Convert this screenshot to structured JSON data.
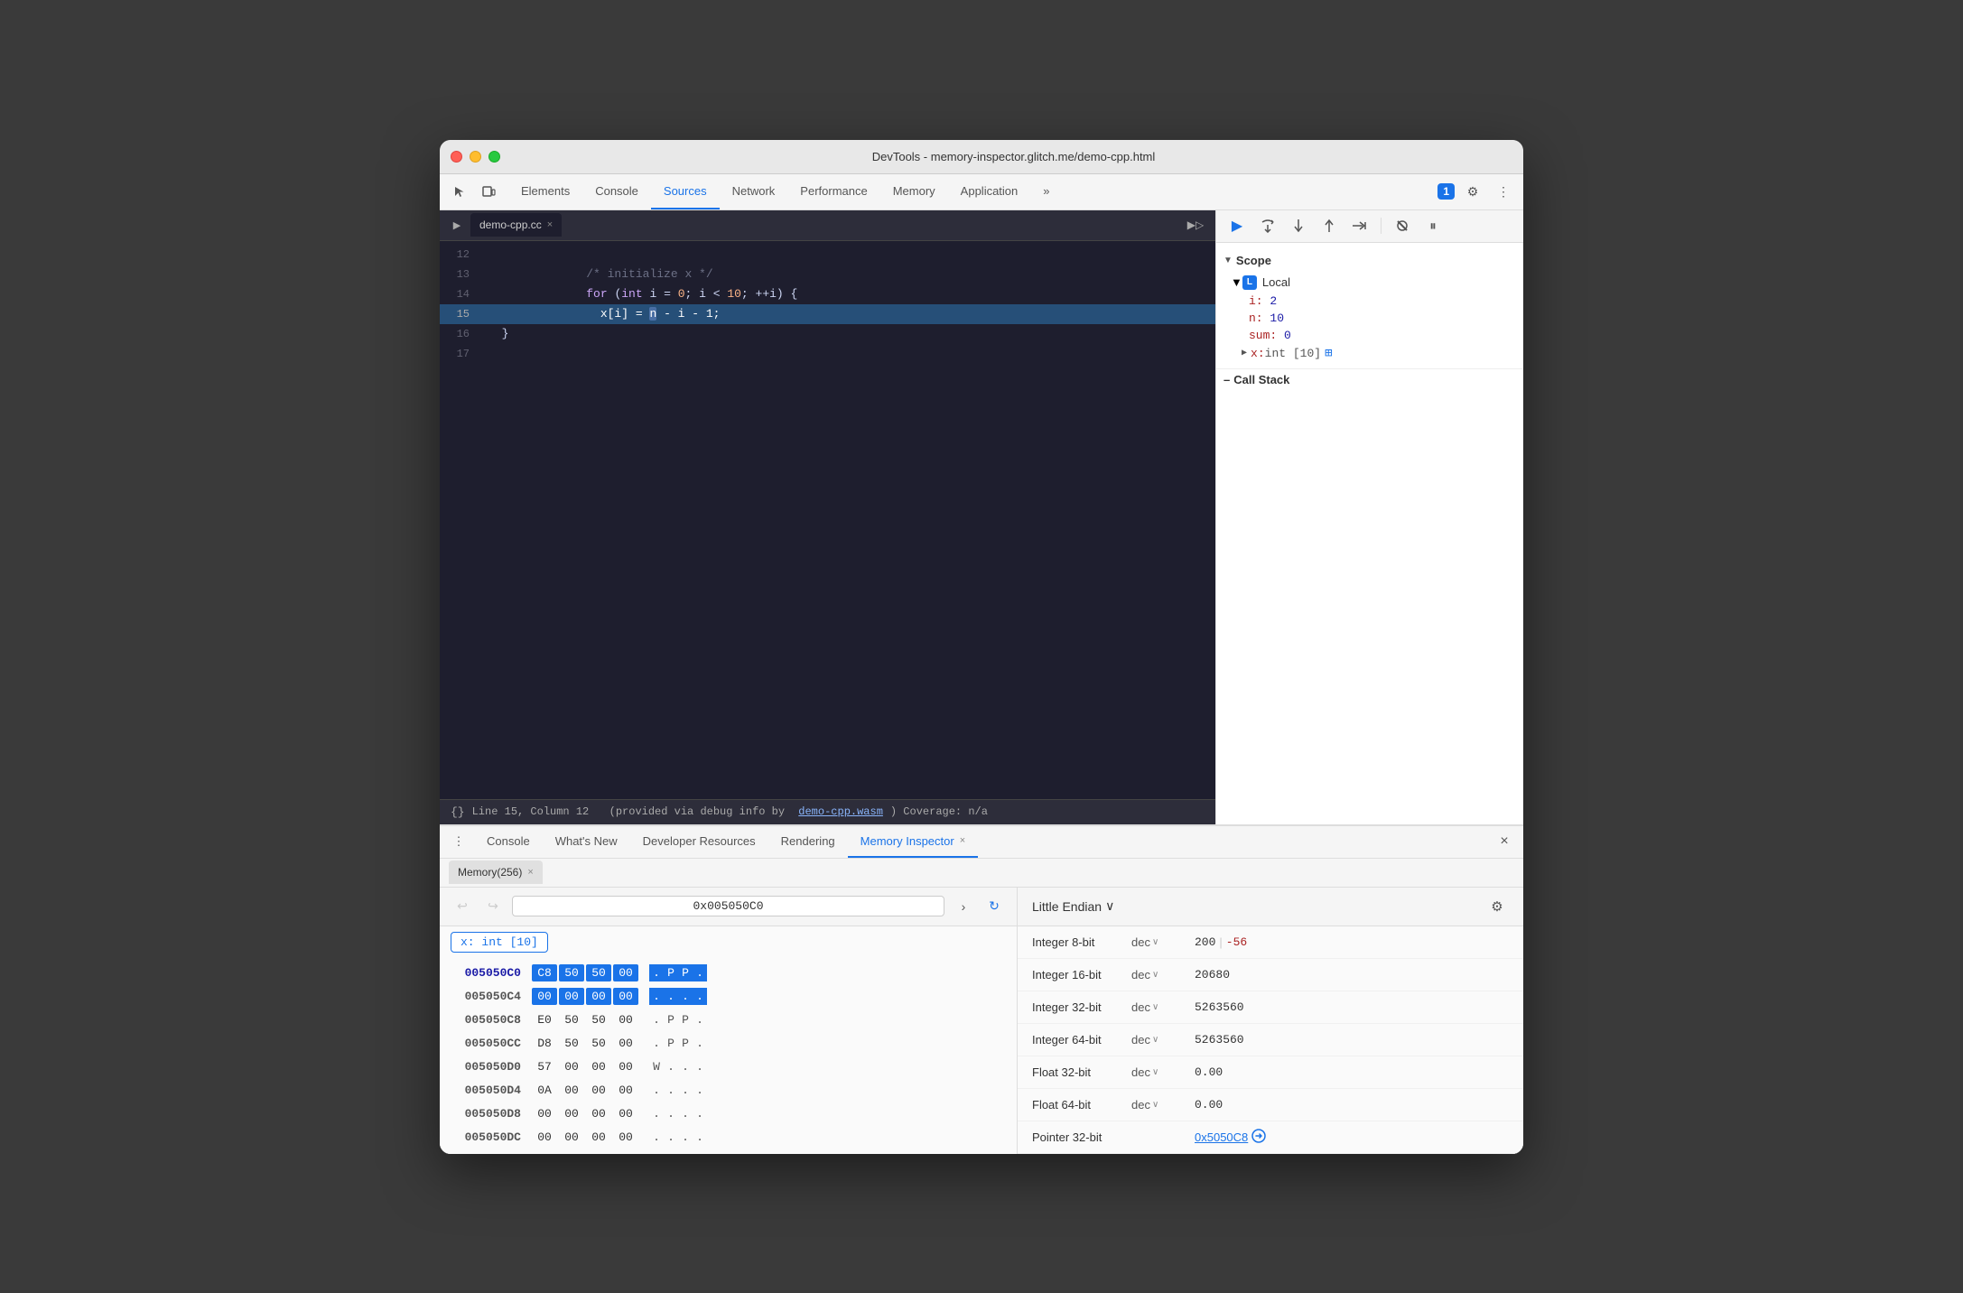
{
  "window": {
    "title": "DevTools - memory-inspector.glitch.me/demo-cpp.html"
  },
  "titlebar_traffic": {
    "red": "close",
    "yellow": "minimize",
    "green": "maximize"
  },
  "devtools": {
    "tabs": [
      {
        "label": "Elements",
        "active": false
      },
      {
        "label": "Console",
        "active": false
      },
      {
        "label": "Sources",
        "active": true
      },
      {
        "label": "Network",
        "active": false
      },
      {
        "label": "Performance",
        "active": false
      },
      {
        "label": "Memory",
        "active": false
      },
      {
        "label": "Application",
        "active": false
      }
    ],
    "more_tabs": "»",
    "badge_count": "1",
    "settings_icon": "⚙",
    "more_icon": "⋮"
  },
  "file_tab": {
    "name": "demo-cpp.cc",
    "close": "×"
  },
  "code": {
    "lines": [
      {
        "num": "12",
        "content": "",
        "highlighted": false
      },
      {
        "num": "13",
        "content": "  /* initialize x */",
        "highlighted": false,
        "type": "comment"
      },
      {
        "num": "14",
        "content": "  for (int i = 0; i < 10; ++i) {",
        "highlighted": false
      },
      {
        "num": "15",
        "content": "    x[i] = n - i - 1;",
        "highlighted": true
      },
      {
        "num": "16",
        "content": "  }",
        "highlighted": false
      },
      {
        "num": "17",
        "content": "",
        "highlighted": false
      }
    ],
    "status": "Line 15, Column 12",
    "status_info": "(provided via debug info by",
    "status_link": "demo-cpp.wasm",
    "status_coverage": ") Coverage: n/a"
  },
  "debug_toolbar": {
    "resume": "▶",
    "step_over": "⤼",
    "step_into": "↓",
    "step_out": "↑",
    "step": "→→",
    "deactivate": "⊘",
    "pause": "⏸"
  },
  "scope": {
    "header": "Scope",
    "local_badge": "L",
    "local_label": "Local",
    "vars": [
      {
        "name": "i:",
        "val": "2"
      },
      {
        "name": "n:",
        "val": "10"
      },
      {
        "name": "sum:",
        "val": "0"
      }
    ],
    "var_x": {
      "name": "x:",
      "type": "int [10]",
      "memory_icon": "⊞"
    },
    "call_stack_label": "Call Stack"
  },
  "bottom": {
    "menu_icon": "⋮",
    "tabs": [
      {
        "label": "Console",
        "active": false
      },
      {
        "label": "What's New",
        "active": false
      },
      {
        "label": "Developer Resources",
        "active": false
      },
      {
        "label": "Rendering",
        "active": false
      },
      {
        "label": "Memory Inspector",
        "active": true,
        "closeable": true
      }
    ],
    "close_icon": "×"
  },
  "memory_subtab": {
    "label": "Memory(256)",
    "close": "×"
  },
  "memory_nav": {
    "back_icon": "↩",
    "fwd_icon_disabled": "↪",
    "address": "0x005050C0",
    "next_icon": "›",
    "refresh_icon": "↻"
  },
  "var_badge": {
    "label": "x: int [10]"
  },
  "hex_rows": [
    {
      "addr": "005050C0",
      "current": true,
      "bytes": [
        {
          "val": "C8",
          "sel": "blue"
        },
        {
          "val": "50",
          "sel": "blue"
        },
        {
          "val": "50",
          "sel": "blue"
        },
        {
          "val": "00",
          "sel": "blue"
        }
      ],
      "chars": [
        {
          "val": ".",
          "sel": "blue"
        },
        {
          "val": "P",
          "sel": "blue"
        },
        {
          "val": "P",
          "sel": "blue"
        },
        {
          "val": ".",
          "sel": "blue"
        }
      ]
    },
    {
      "addr": "005050C4",
      "current": false,
      "bytes": [
        {
          "val": "00",
          "sel": "blue"
        },
        {
          "val": "00",
          "sel": "blue"
        },
        {
          "val": "00",
          "sel": "blue"
        },
        {
          "val": "00",
          "sel": "blue"
        }
      ],
      "chars": [
        {
          "val": ".",
          "sel": "blue"
        },
        {
          "val": ".",
          "sel": "blue"
        },
        {
          "val": ".",
          "sel": "blue"
        },
        {
          "val": ".",
          "sel": "blue"
        }
      ]
    },
    {
      "addr": "005050C8",
      "current": false,
      "bytes": [
        {
          "val": "E0",
          "sel": "none"
        },
        {
          "val": "50",
          "sel": "none"
        },
        {
          "val": "50",
          "sel": "none"
        },
        {
          "val": "00",
          "sel": "none"
        }
      ],
      "chars": [
        {
          "val": ".",
          "sel": "none"
        },
        {
          "val": "P",
          "sel": "none"
        },
        {
          "val": "P",
          "sel": "none"
        },
        {
          "val": ".",
          "sel": "none"
        }
      ]
    },
    {
      "addr": "005050CC",
      "current": false,
      "bytes": [
        {
          "val": "D8",
          "sel": "none"
        },
        {
          "val": "50",
          "sel": "none"
        },
        {
          "val": "50",
          "sel": "none"
        },
        {
          "val": "00",
          "sel": "none"
        }
      ],
      "chars": [
        {
          "val": ".",
          "sel": "none"
        },
        {
          "val": "P",
          "sel": "none"
        },
        {
          "val": "P",
          "sel": "none"
        },
        {
          "val": ".",
          "sel": "none"
        }
      ]
    },
    {
      "addr": "005050D0",
      "current": false,
      "bytes": [
        {
          "val": "57",
          "sel": "none"
        },
        {
          "val": "00",
          "sel": "none"
        },
        {
          "val": "00",
          "sel": "none"
        },
        {
          "val": "00",
          "sel": "none"
        }
      ],
      "chars": [
        {
          "val": "W",
          "sel": "none"
        },
        {
          "val": ".",
          "sel": "none"
        },
        {
          "val": ".",
          "sel": "none"
        },
        {
          "val": ".",
          "sel": "none"
        }
      ]
    },
    {
      "addr": "005050D4",
      "current": false,
      "bytes": [
        {
          "val": "0A",
          "sel": "none"
        },
        {
          "val": "00",
          "sel": "none"
        },
        {
          "val": "00",
          "sel": "none"
        },
        {
          "val": "00",
          "sel": "none"
        }
      ],
      "chars": [
        {
          "val": ".",
          "sel": "none"
        },
        {
          "val": ".",
          "sel": "none"
        },
        {
          "val": ".",
          "sel": "none"
        },
        {
          "val": ".",
          "sel": "none"
        }
      ]
    },
    {
      "addr": "005050D8",
      "current": false,
      "bytes": [
        {
          "val": "00",
          "sel": "none"
        },
        {
          "val": "00",
          "sel": "none"
        },
        {
          "val": "00",
          "sel": "none"
        },
        {
          "val": "00",
          "sel": "none"
        }
      ],
      "chars": [
        {
          "val": ".",
          "sel": "none"
        },
        {
          "val": ".",
          "sel": "none"
        },
        {
          "val": ".",
          "sel": "none"
        },
        {
          "val": ".",
          "sel": "none"
        }
      ]
    },
    {
      "addr": "005050DC",
      "current": false,
      "bytes": [
        {
          "val": "00",
          "sel": "none"
        },
        {
          "val": "00",
          "sel": "none"
        },
        {
          "val": "00",
          "sel": "none"
        },
        {
          "val": "00",
          "sel": "none"
        }
      ],
      "chars": [
        {
          "val": ".",
          "sel": "none"
        },
        {
          "val": ".",
          "sel": "none"
        },
        {
          "val": ".",
          "sel": "none"
        },
        {
          "val": ".",
          "sel": "none"
        }
      ]
    }
  ],
  "memory_values": {
    "endian": "Little Endian",
    "endian_chevron": "∨",
    "gear": "⚙",
    "rows": [
      {
        "type": "Integer 8-bit",
        "enc": "dec",
        "val": "200",
        "sep": "|",
        "neg": "-56"
      },
      {
        "type": "Integer 16-bit",
        "enc": "dec",
        "val": "20680",
        "neg": null
      },
      {
        "type": "Integer 32-bit",
        "enc": "dec",
        "val": "5263560",
        "neg": null
      },
      {
        "type": "Integer 64-bit",
        "enc": "dec",
        "val": "5263560",
        "neg": null
      },
      {
        "type": "Float 32-bit",
        "enc": "dec",
        "val": "0.00",
        "neg": null
      },
      {
        "type": "Float 64-bit",
        "enc": "dec",
        "val": "0.00",
        "neg": null
      },
      {
        "type": "Pointer 32-bit",
        "enc": null,
        "val": "0x5050C8",
        "is_pointer": true
      }
    ]
  }
}
